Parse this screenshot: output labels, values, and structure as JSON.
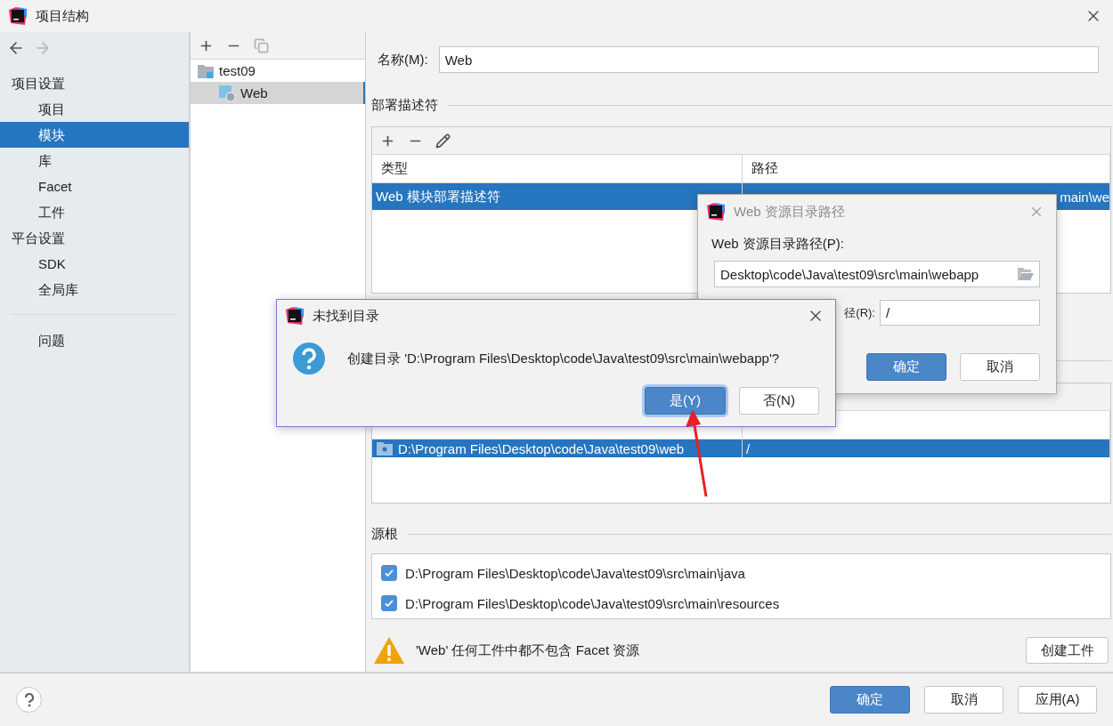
{
  "window": {
    "title": "项目结构"
  },
  "nav_buttons": [
    {
      "kind": "back",
      "disabled": false
    },
    {
      "kind": "forward",
      "disabled": true
    }
  ],
  "sidebar": {
    "sections": [
      {
        "title": "项目设置",
        "items": [
          {
            "label": "项目",
            "selected": false
          },
          {
            "label": "模块",
            "selected": true
          },
          {
            "label": "库",
            "selected": false
          },
          {
            "label": "Facet",
            "selected": false
          },
          {
            "label": "工件",
            "selected": false
          }
        ]
      },
      {
        "title": "平台设置",
        "items": [
          {
            "label": "SDK",
            "selected": false
          },
          {
            "label": "全局库",
            "selected": false
          }
        ]
      }
    ],
    "extra_items": [
      {
        "label": "问题",
        "selected": false
      }
    ]
  },
  "module_tree": {
    "toolbar": [
      {
        "kind": "add",
        "disabled": false
      },
      {
        "kind": "remove",
        "disabled": false
      },
      {
        "kind": "copy",
        "disabled": true
      }
    ],
    "items": [
      {
        "label": "test09",
        "selected": false,
        "children": [
          {
            "label": "Web",
            "selected": true
          }
        ]
      }
    ]
  },
  "name_field": {
    "label": "名称(M):",
    "value": "Web"
  },
  "deployment": {
    "title": "部署描述符",
    "toolbar": [
      {
        "kind": "add"
      },
      {
        "kind": "remove"
      },
      {
        "kind": "edit"
      }
    ],
    "columns": [
      "类型",
      "路径"
    ],
    "rows": [
      {
        "cells": [
          "Web 模块部署描述符",
          "main\\we"
        ],
        "selected": true
      }
    ]
  },
  "web_resources": {
    "rows": [
      {
        "cells": [
          "D:\\Program Files\\Desktop\\code\\Java\\test09\\web",
          "/"
        ],
        "selected": true
      }
    ]
  },
  "source_roots": {
    "title": "源根",
    "items": [
      {
        "label": "D:\\Program Files\\Desktop\\code\\Java\\test09\\src\\main\\java",
        "checked": true
      },
      {
        "label": "D:\\Program Files\\Desktop\\code\\Java\\test09\\src\\main\\resources",
        "checked": true
      }
    ]
  },
  "warning": {
    "text": "'Web' 任何工件中都不包含 Facet 资源",
    "button": "创建工件"
  },
  "footer": {
    "buttons": [
      {
        "label": "确定",
        "kind": "primary"
      },
      {
        "label": "取消",
        "kind": "normal"
      },
      {
        "label": "应用(A)",
        "kind": "normal"
      }
    ]
  },
  "resource_dialog": {
    "title": "Web 资源目录路径",
    "path_label": "Web 资源目录路径(P):",
    "path_value": "Desktop\\code\\Java\\test09\\src\\main\\webapp",
    "relative_label": "径(R):",
    "relative_value": "/",
    "buttons": [
      {
        "label": "确定",
        "kind": "primary"
      },
      {
        "label": "取消",
        "kind": "normal"
      }
    ]
  },
  "confirm_dialog": {
    "title": "未找到目录",
    "message": "创建目录 'D:\\Program Files\\Desktop\\code\\Java\\test09\\src\\main\\webapp'?",
    "buttons": [
      {
        "label": "是(Y)",
        "kind": "primary",
        "focused": true
      },
      {
        "label": "否(N)",
        "kind": "normal",
        "focused": false
      }
    ]
  }
}
